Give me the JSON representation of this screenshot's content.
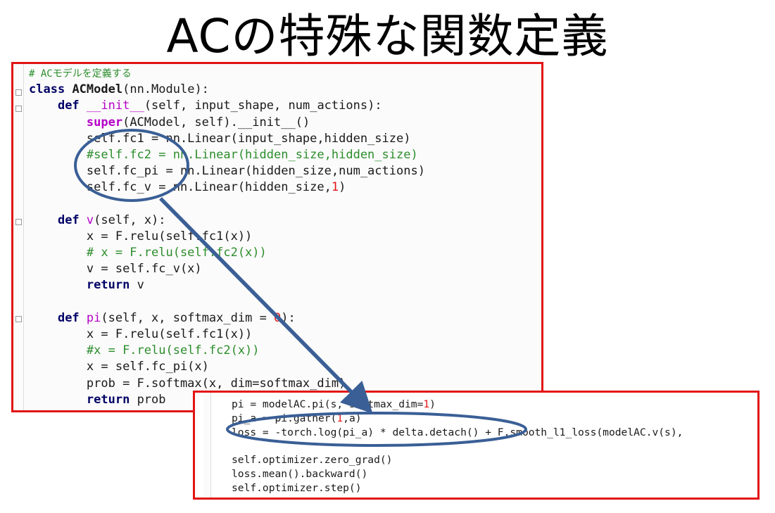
{
  "title": "ACの特殊な関数定義",
  "main_code": {
    "comment_header": "# ACモデルを定義する",
    "class_kw": "class",
    "class_name": "ACModel",
    "class_args": "(nn.Module):",
    "init_def_kw": "def",
    "init_name": "__init__",
    "init_args": "(self, input_shape, num_actions):",
    "super_kw": "super",
    "super_rest": "(ACModel, self).__init__()",
    "fc1_line": "self.fc1 = nn.Linear(input_shape,hidden_size)",
    "fc2_comment": "#self.fc2 = nn.Linear(hidden_size,hidden_size)",
    "fcpi_line": "self.fc_pi = nn.Linear(hidden_size,num_actions)",
    "fcv_line_pre": "self.fc_v = nn.Linear(hidden_size,",
    "fcv_num": "1",
    "fcv_line_post": ")",
    "v_def_kw": "def",
    "v_name": "v",
    "v_args": "(self, x):",
    "v_relu": "x = F.relu(self.fc1(x))",
    "v_comment": "# x = F.relu(self.fc2(x))",
    "v_assign": "v = self.fc_v(x)",
    "return_kw": "return",
    "v_return_val": "v",
    "pi_def_kw": "def",
    "pi_name": "pi",
    "pi_args_pre": "(self, x, softmax_dim = ",
    "pi_args_num": "0",
    "pi_args_post": "):",
    "pi_relu": "x = F.relu(self.fc1(x))",
    "pi_comment": "#x = F.relu(self.fc2(x))",
    "pi_fcpi": "x = self.fc_pi(x)",
    "pi_prob": "prob = F.softmax(x, dim=softmax_dim)",
    "pi_return_kw": "return",
    "pi_return_val": "prob"
  },
  "loss_code": {
    "line1_pre": "pi = modelAC.pi(s, softmax_dim=",
    "line1_num": "1",
    "line1_post": ")",
    "line2_pre": "pi_a = pi.gather(",
    "line2_num": "1",
    "line2_post": ",a)",
    "line3": "loss = -torch.log(pi_a) * delta.detach() + F.smooth_l1_loss(modelAC.v(s),",
    "line5": "self.optimizer.zero_grad()",
    "line6": "loss.mean().backward()",
    "line7": "self.optimizer.step()"
  },
  "colors": {
    "panel_border": "#e21414",
    "annotation": "#3a5f96",
    "comment": "#2c8d2c",
    "keyword": "#000066",
    "builtin": "#b400c8",
    "number": "#e21414"
  }
}
